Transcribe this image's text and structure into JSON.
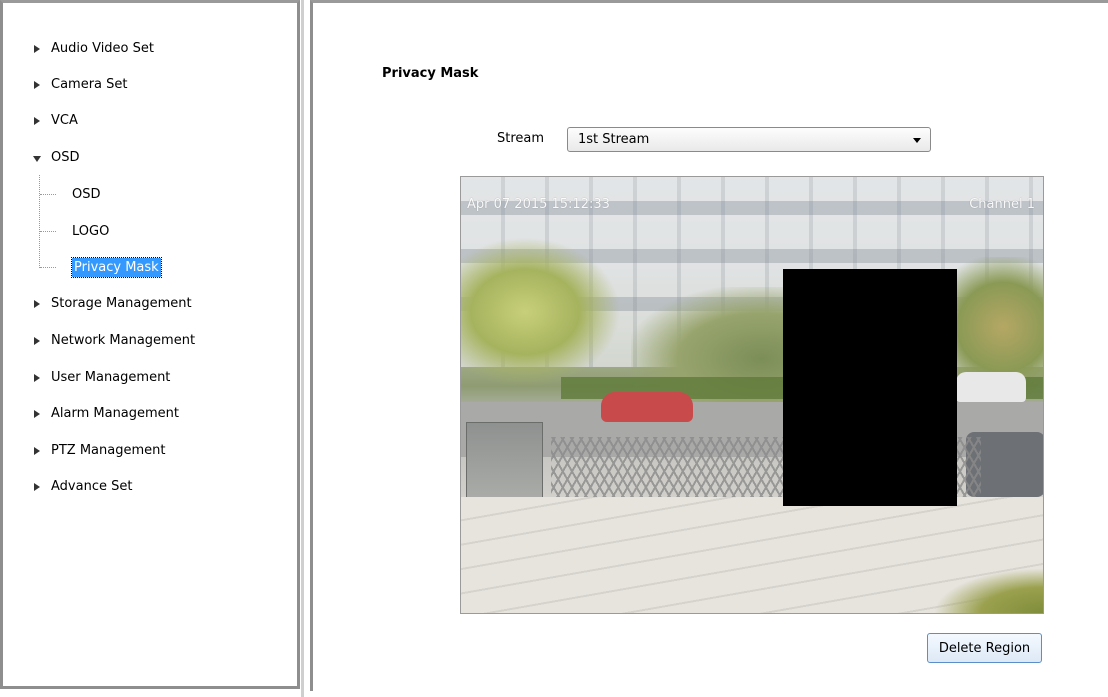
{
  "sidebar": {
    "items": [
      {
        "label": "Audio Video Set",
        "expanded": false
      },
      {
        "label": "Camera Set",
        "expanded": false
      },
      {
        "label": "VCA",
        "expanded": false
      },
      {
        "label": "OSD",
        "expanded": true,
        "children": [
          {
            "label": "OSD",
            "selected": false
          },
          {
            "label": "LOGO",
            "selected": false
          },
          {
            "label": "Privacy Mask",
            "selected": true
          }
        ]
      },
      {
        "label": "Storage Management",
        "expanded": false
      },
      {
        "label": "Network Management",
        "expanded": false
      },
      {
        "label": "User Management",
        "expanded": false
      },
      {
        "label": "Alarm Management",
        "expanded": false
      },
      {
        "label": "PTZ Management",
        "expanded": false
      },
      {
        "label": "Advance Set",
        "expanded": false
      }
    ]
  },
  "main": {
    "title": "Privacy Mask",
    "stream": {
      "label": "Stream",
      "value": "1st Stream"
    },
    "video": {
      "osd_time": "Apr 07 2015 15:12:33",
      "osd_channel": "Channel 1"
    },
    "delete_button": "Delete Region"
  },
  "colors": {
    "selection": "#3399ff",
    "mask": "#000000",
    "button_border": "#5b8fc9"
  }
}
